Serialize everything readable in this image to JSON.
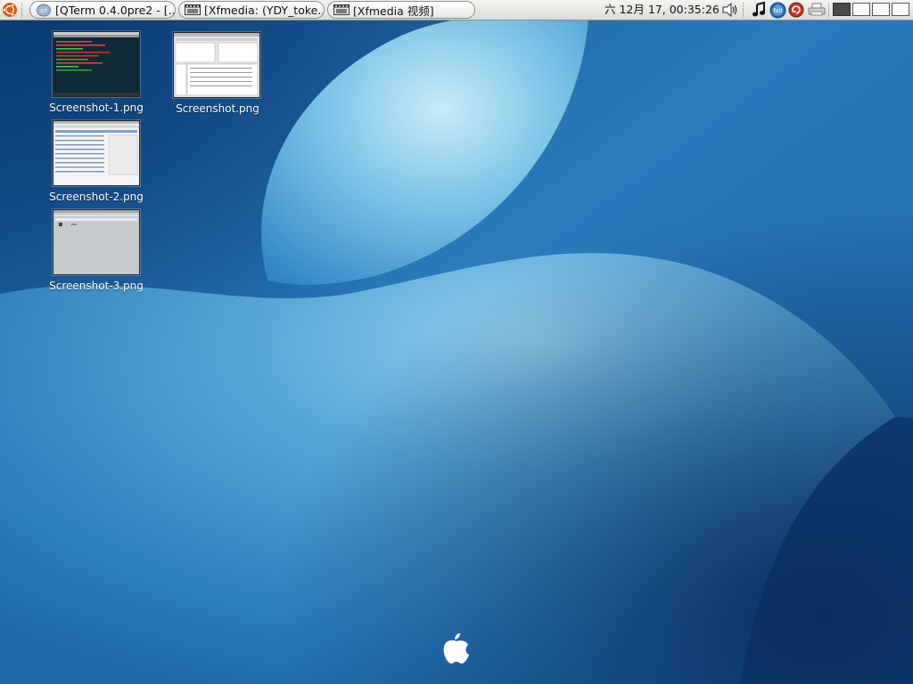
{
  "panel": {
    "menu_icon": "ubuntu-logo-icon",
    "tasks": [
      {
        "label": "[QTerm 0.4.0pre2 - [...",
        "icon": "qterm-icon"
      },
      {
        "label": "[Xfmedia: (YDY_toke...",
        "icon": "film-icon"
      },
      {
        "label": "[Xfmedia 视频]",
        "icon": "film-icon"
      }
    ],
    "clock": "六 12月 17, 00:35:26",
    "volume_icon": "speaker-icon",
    "tray_icons": [
      "music-note-icon",
      "network-globe-icon",
      "update-icon",
      "printer-icon"
    ],
    "workspaces": {
      "count": 4,
      "active": 1
    }
  },
  "desktop": {
    "icons": [
      {
        "label": "Screenshot-1.png",
        "thumb": "dark-terminal"
      },
      {
        "label": "Screenshot.png",
        "thumb": "file-browser"
      },
      {
        "label": "Screenshot-2.png",
        "thumb": "web-browser"
      },
      {
        "label": "Screenshot-3.png",
        "thumb": "gray-window"
      }
    ],
    "wallpaper_colors": {
      "deep": "#0d3f78",
      "mid": "#2f86c4",
      "light": "#bfe6f4"
    },
    "center_logo": "apple-logo-icon"
  }
}
